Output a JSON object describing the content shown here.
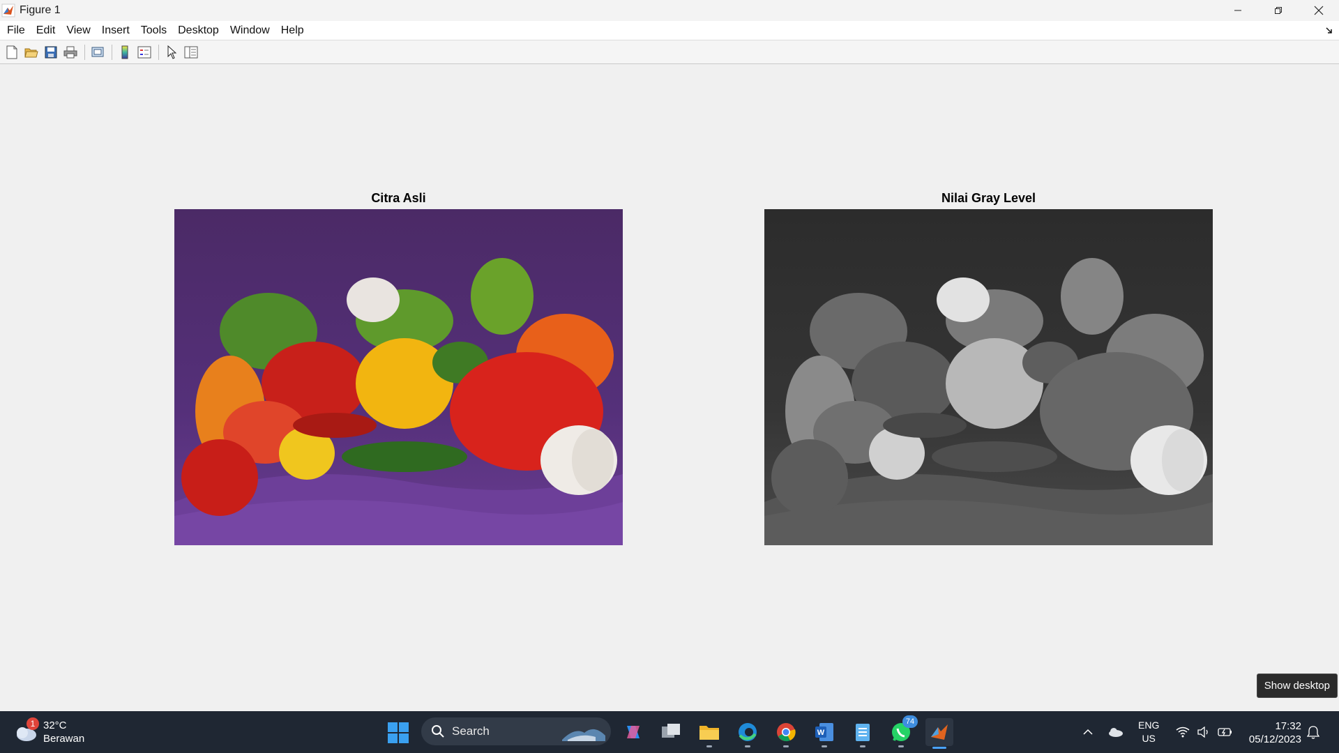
{
  "window": {
    "title": "Figure 1",
    "app_icon": "matlab-icon"
  },
  "menu": {
    "items": [
      "File",
      "Edit",
      "View",
      "Insert",
      "Tools",
      "Desktop",
      "Window",
      "Help"
    ]
  },
  "toolbar": {
    "buttons": [
      "new-figure-icon",
      "open-file-icon",
      "save-icon",
      "print-icon",
      "print-preview-icon",
      "colorbar-icon",
      "legend-icon",
      "edit-plot-arrow-icon",
      "property-inspector-icon"
    ]
  },
  "figure": {
    "left_axes_title": "Citra Asli",
    "right_axes_title": "Nilai Gray Level"
  },
  "tooltip": {
    "text": "Show desktop"
  },
  "taskbar": {
    "weather": {
      "temp": "32°C",
      "condition": "Berawan",
      "badge": "1"
    },
    "search_label": "Search",
    "whatsapp_badge": "74",
    "language": {
      "line1": "ENG",
      "line2": "US"
    },
    "clock": {
      "time": "17:32",
      "date": "05/12/2023"
    }
  },
  "colors": {
    "taskbar_bg": "#1f2733",
    "figure_bg": "#f0f0f0",
    "accent": "#4aa3ff"
  }
}
